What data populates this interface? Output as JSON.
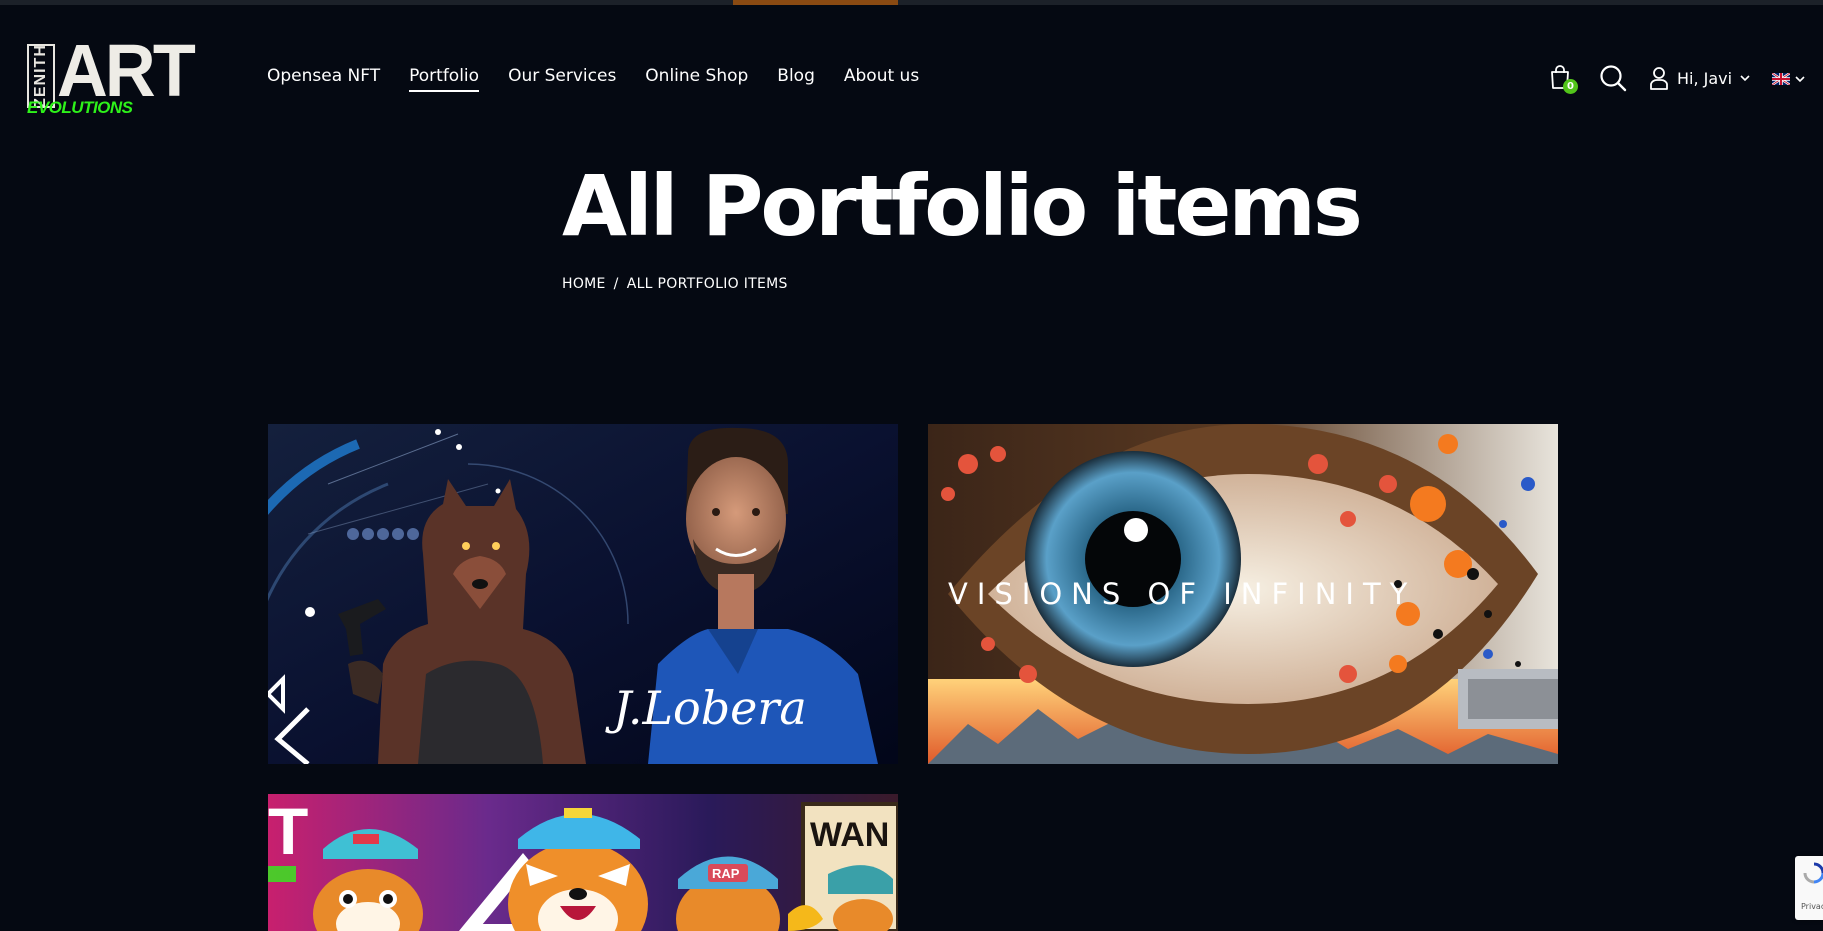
{
  "logo": {
    "word_vertical": "ZENITH",
    "word_main": "ART",
    "word_sub": "EVOLUTIONS"
  },
  "nav": [
    {
      "label": "Opensea NFT",
      "active": false
    },
    {
      "label": "Portfolio",
      "active": true
    },
    {
      "label": "Our Services",
      "active": false
    },
    {
      "label": "Online Shop",
      "active": false
    },
    {
      "label": "Blog",
      "active": false
    },
    {
      "label": "About us",
      "active": false
    }
  ],
  "header": {
    "cart_count": "0",
    "greeting": "Hi, Javi",
    "icons": [
      "shopping-bag-icon",
      "search-icon",
      "user-icon",
      "chevron-down-icon",
      "uk-flag-icon"
    ]
  },
  "page": {
    "title": "All Portfolio items",
    "breadcrumb": {
      "home": "HOME",
      "separator": "/",
      "current": "ALL PORTFOLIO ITEMS"
    }
  },
  "portfolio": {
    "items": [
      {
        "image_text": "J.Lobera"
      },
      {
        "image_text": "VISIONS OF INFINITY"
      },
      {
        "image_text_left": "T",
        "image_text_right": "WAN",
        "badge": "RAP"
      }
    ]
  },
  "recaptcha": {
    "label": "Privacy"
  },
  "colors": {
    "background": "#050912",
    "text": "#ffffff",
    "accent_progress": "#8a4a12",
    "badge": "#52c41a",
    "logo_green": "#2ef21a"
  }
}
